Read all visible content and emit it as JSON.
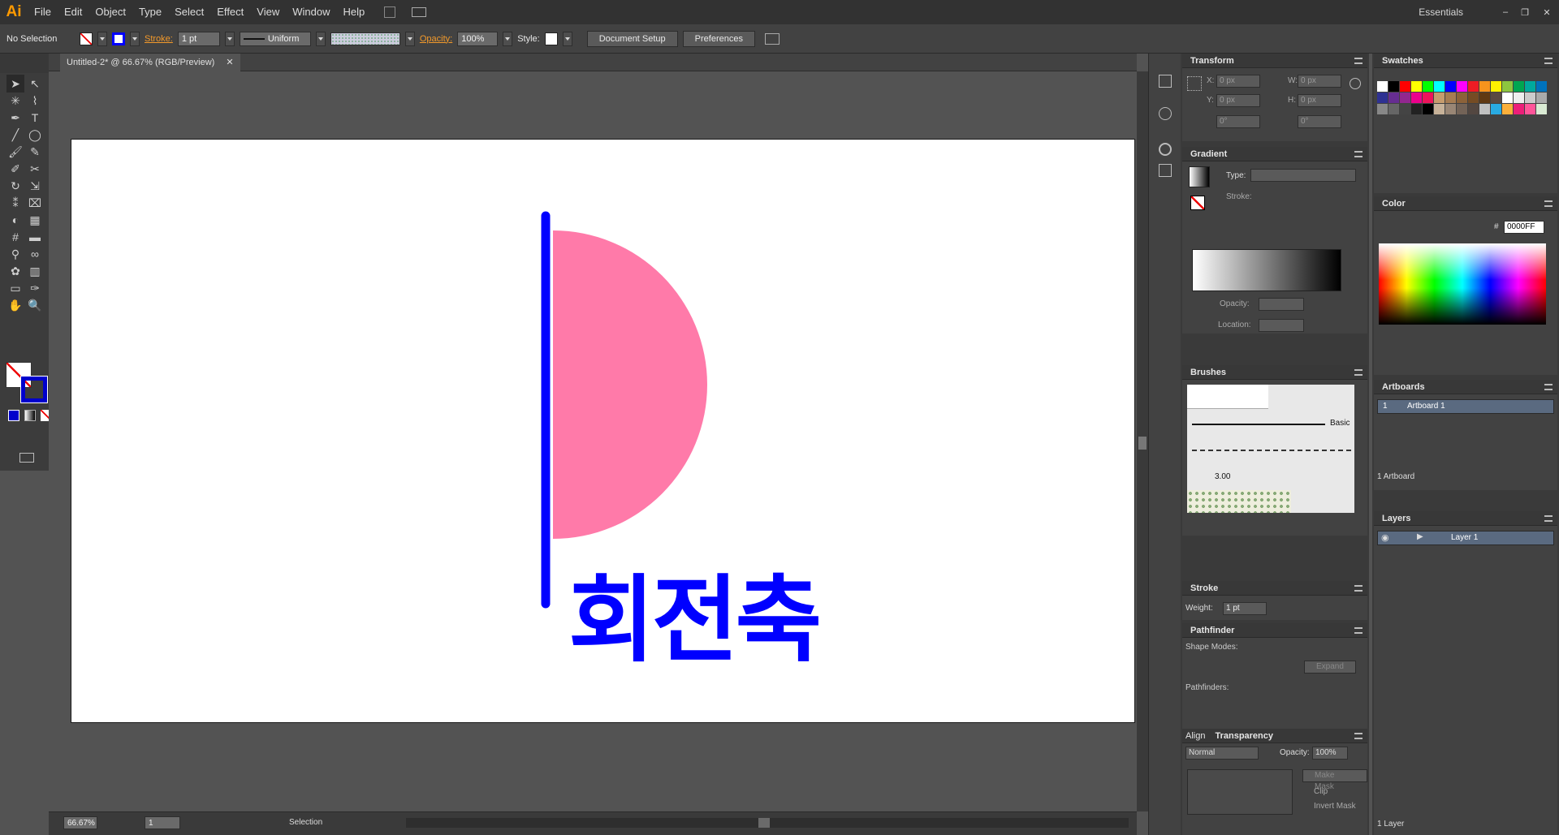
{
  "app": {
    "logo": "Ai",
    "workspace": "Essentials"
  },
  "menu": [
    "File",
    "Edit",
    "Object",
    "Type",
    "Select",
    "Effect",
    "View",
    "Window",
    "Help"
  ],
  "control": {
    "selection": "No Selection",
    "stroke_label": "Stroke:",
    "stroke_weight": "1 pt",
    "profile": "Uniform",
    "opacity_label": "Opacity:",
    "opacity": "100%",
    "style_label": "Style:",
    "document_setup": "Document Setup",
    "preferences": "Preferences"
  },
  "document": {
    "tab": "Untitled-2* @ 66.67% (RGB/Preview)"
  },
  "artwork": {
    "text": "회전축",
    "shape_color": "#ff7aa9",
    "stroke_color": "#0000ff"
  },
  "status": {
    "zoom": "66.67%",
    "artboard_nav": "1",
    "tool": "Selection"
  },
  "transform": {
    "title": "Transform",
    "x_label": "X:",
    "y_label": "Y:",
    "w_label": "W:",
    "h_label": "H:",
    "x": "0 px",
    "y": "0 px",
    "w": "0 px",
    "h": "0 px",
    "angle": "0°",
    "shear": "0°"
  },
  "gradient": {
    "title": "Gradient",
    "type_label": "Type:",
    "stroke_label": "Stroke:",
    "opacity_label": "Opacity:",
    "location_label": "Location:"
  },
  "brushes": {
    "title": "Brushes",
    "basic": "Basic",
    "size": "3.00"
  },
  "stroke_panel": {
    "title": "Stroke",
    "weight_label": "Weight:",
    "weight": "1 pt"
  },
  "pathfinder": {
    "title": "Pathfinder",
    "shape_modes": "Shape Modes:",
    "pathfinders": "Pathfinders:",
    "expand": "Expand"
  },
  "transparency": {
    "align_tab": "Align",
    "title": "Transparency",
    "blend": "Normal",
    "opacity_label": "Opacity:",
    "opacity": "100%",
    "make_mask": "Make Mask",
    "clip": "Clip",
    "invert": "Invert Mask"
  },
  "swatches": {
    "title": "Swatches"
  },
  "color": {
    "title": "Color",
    "hex_label": "#",
    "hex": "0000FF"
  },
  "artboards": {
    "title": "Artboards",
    "row_num": "1",
    "row_name": "Artboard 1",
    "count": "1 Artboard"
  },
  "layers": {
    "title": "Layers",
    "layer_name": "Layer 1",
    "count": "1 Layer"
  }
}
